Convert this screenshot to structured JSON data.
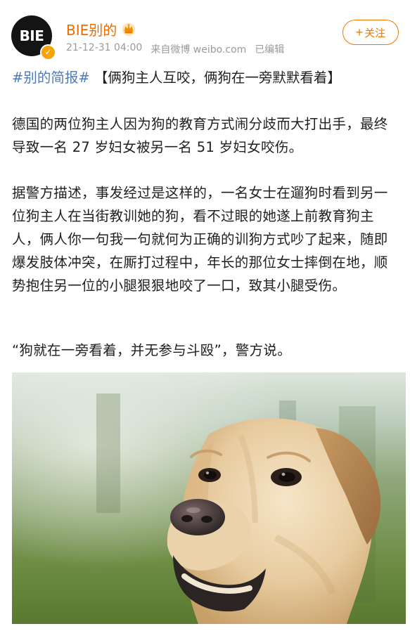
{
  "account": {
    "avatar_text": "BIE",
    "name": "BIE别的",
    "timestamp": "21-12-31 04:00",
    "source": "来自微博 weibo.com",
    "edited": "已编辑",
    "follow_label": "关注"
  },
  "post": {
    "topic": "#别的简报#",
    "title": "【俩狗主人互咬，俩狗在一旁默默看着】",
    "paragraphs": [
      "德国的两位狗主人因为狗的教育方式闹分歧而大打出手，最终导致一名 27 岁妇女被另一名 51 岁妇女咬伤。",
      "据警方描述，事发经过是这样的，一名女士在遛狗时看到另一位狗主人在当街教训她的狗，看不过眼的她遂上前教育狗主人，俩人你一句我一句就何为正确的训狗方式吵了起来，随即爆发肢体冲突，在厮打过程中，年长的那位女士摔倒在地，顺势抱住另一位的小腿狠狠地咬了一口，致其小腿受伤。",
      "“狗就在一旁看着，并无参与斗殴”，警方说。"
    ]
  },
  "icons": {
    "crown": "crown-icon",
    "verified": "verified-badge-icon",
    "plus": "plus-icon"
  },
  "colors": {
    "name": "#f06b00",
    "topic": "#4e79b8",
    "follow_border": "#f07800",
    "verified_badge": "#f7a300",
    "meta": "#9a9a9a"
  }
}
